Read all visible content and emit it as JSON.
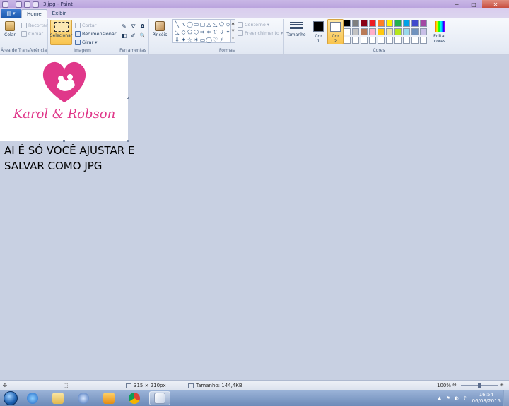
{
  "window": {
    "title": "3.jpg - Paint",
    "minimize_glyph": "─",
    "maximize_glyph": "□",
    "close_glyph": "✕"
  },
  "tabs": {
    "file_glyph": "▤ ▾",
    "home": "Home",
    "view": "Exibir"
  },
  "ribbon": {
    "clipboard": {
      "label": "Área de Transferência",
      "paste": "Colar",
      "cut": "Recortar",
      "copy": "Copiar"
    },
    "image": {
      "label": "Imagem",
      "select": "Selecionar",
      "crop": "Cortar",
      "resize": "Redimensionar",
      "rotate": "Girar ▾"
    },
    "tools": {
      "label": "Ferramentas",
      "icons": [
        "✎",
        "⛛",
        "A",
        "◧",
        "✐",
        "🔍"
      ]
    },
    "brushes": {
      "label": "Pincéis"
    },
    "shapes": {
      "label": "Formas",
      "outline": "Contorno ▾",
      "fill": "Preenchimento ▾",
      "glyphs": [
        "╲",
        "∿",
        "◯",
        "▭",
        "▢",
        "△",
        "◺",
        "⬠",
        "◇",
        "◺",
        "◇",
        "⬠",
        "⬡",
        "⇨",
        "⇦",
        "⇧",
        "⇩",
        "✦",
        "⇩",
        "✦",
        "☆",
        "✶",
        "▭",
        "◯",
        "♡",
        "⚡"
      ]
    },
    "size": {
      "label": "Tamanho"
    },
    "colors": {
      "label": "Cores",
      "color1": "Cor\n1",
      "color2": "Cor\n2",
      "color1_value": "#000000",
      "color2_value": "#ffffff",
      "edit": "Editar\ncores",
      "swatches": [
        "#000000",
        "#7f7f7f",
        "#880015",
        "#ed1c24",
        "#ff7f27",
        "#fff200",
        "#22b14c",
        "#00a2e8",
        "#3f48cc",
        "#a349a4",
        "#ffffff",
        "#c3c3c3",
        "#b97a57",
        "#ffaec9",
        "#ffc90e",
        "#efe4b0",
        "#b5e61d",
        "#99d9ea",
        "#7092be",
        "#c8bfe7",
        "#ffffff",
        "#ffffff",
        "#ffffff",
        "#ffffff",
        "#ffffff",
        "#ffffff",
        "#ffffff",
        "#ffffff",
        "#ffffff",
        "#ffffff"
      ]
    }
  },
  "canvas": {
    "logo_text": "Karol & Robson",
    "accent": "#e0388a",
    "caption": "AI É SÓ VOCÊ AJUSTAR E SALVAR COMO JPG"
  },
  "statusbar": {
    "dimensions": "315 × 210px",
    "file_size": "Tamanho: 144,4KB",
    "zoom": "100%",
    "zoom_minus": "⊖",
    "zoom_plus": "⊕"
  },
  "taskbar": {
    "time": "16:54",
    "date": "06/08/2015",
    "tray_glyphs": [
      "▲",
      "⚑",
      "◐",
      "♪"
    ],
    "apps": [
      "ie",
      "explorer",
      "app3",
      "outlook",
      "chrome",
      "paint"
    ]
  }
}
